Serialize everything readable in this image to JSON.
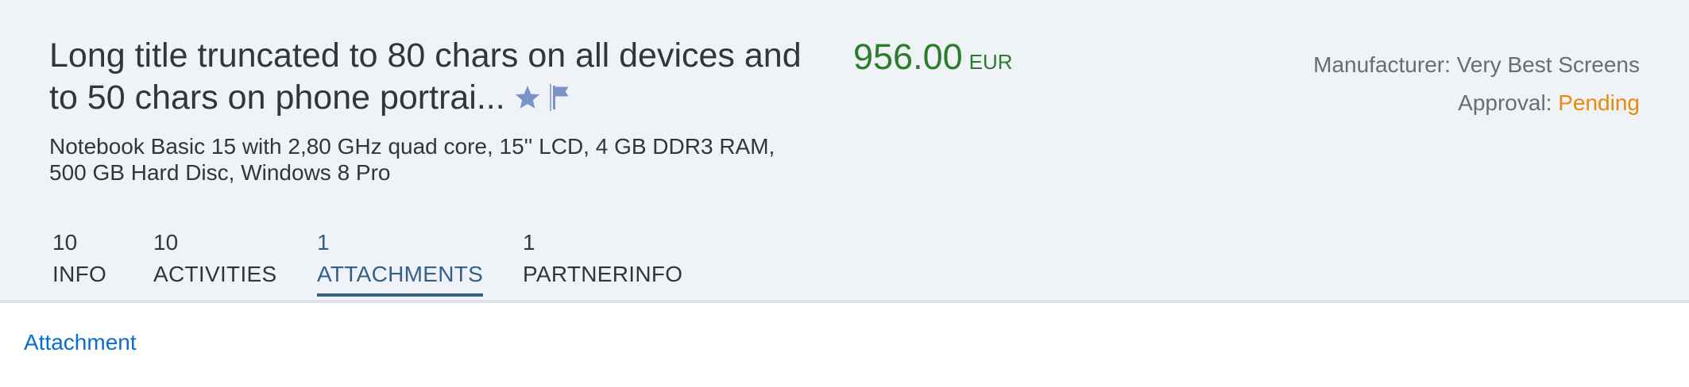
{
  "header": {
    "title": "Long title truncated to 80 chars on all devices and to 50 chars on phone portrai...",
    "subtitle": "Notebook Basic 15 with 2,80 GHz quad core, 15'' LCD, 4 GB DDR3 RAM, 500 GB Hard Disc, Windows 8 Pro",
    "price": {
      "amount": "956.00",
      "currency": "EUR",
      "color": "#2b7d2b"
    },
    "attributes": {
      "manufacturer_label": "Manufacturer:",
      "manufacturer_value": "Very Best Screens",
      "approval_label": "Approval:",
      "approval_value": "Pending",
      "approval_color": "#e78c07"
    },
    "icons": [
      "star-icon",
      "flag-icon"
    ]
  },
  "tabs": [
    {
      "count": "10",
      "label": "INFO",
      "selected": false
    },
    {
      "count": "10",
      "label": "ACTIVITIES",
      "selected": false
    },
    {
      "count": "1",
      "label": "ATTACHMENTS",
      "selected": true
    },
    {
      "count": "1",
      "label": "PARTNERINFO",
      "selected": false
    }
  ],
  "content": {
    "link": "Attachment"
  },
  "colors": {
    "accent": "#346187",
    "header_bg": "#eff2f7",
    "link": "#0a6ed1"
  }
}
